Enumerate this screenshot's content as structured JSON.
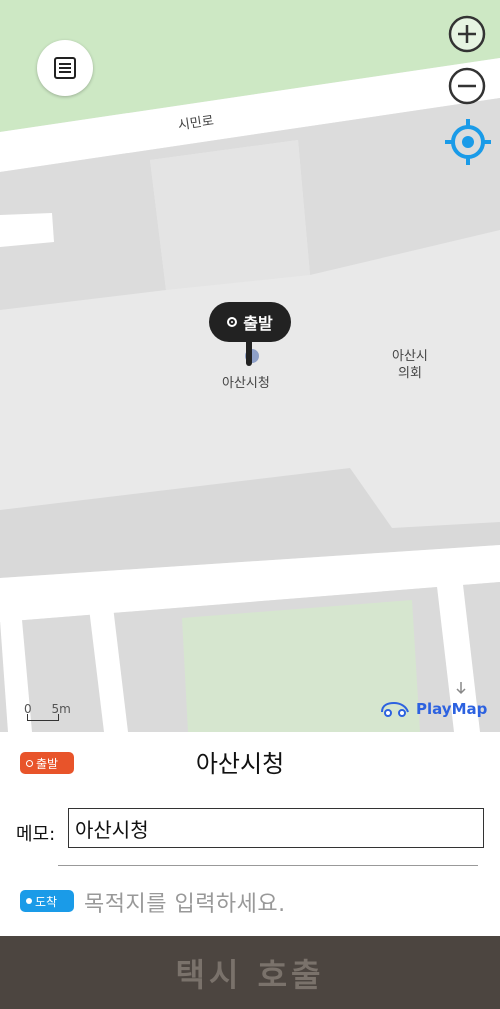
{
  "map": {
    "road_label": "시민로",
    "poi_cityhall": "아산시청",
    "poi_council_line1": "아산시",
    "poi_council_line2": "의회",
    "scale_zero": "0",
    "scale_distance": "5m",
    "provider": "PlayMap"
  },
  "pin": {
    "label": "출발"
  },
  "controls": {
    "menu_icon": "list-icon",
    "zoom_in_icon": "plus-icon",
    "zoom_out_icon": "minus-icon",
    "locate_icon": "crosshair-icon"
  },
  "route": {
    "start_badge": "출발",
    "start_name": "아산시청",
    "memo_label": "메모:",
    "memo_value": "아산시청",
    "dest_badge": "도착",
    "dest_placeholder": "목적지를 입력하세요."
  },
  "call_button": "택시 호출",
  "colors": {
    "start": "#e8542a",
    "dest": "#1a9be8",
    "locate": "#1a9be8",
    "call_bg": "#4c4540",
    "park": "#cde8c4"
  }
}
